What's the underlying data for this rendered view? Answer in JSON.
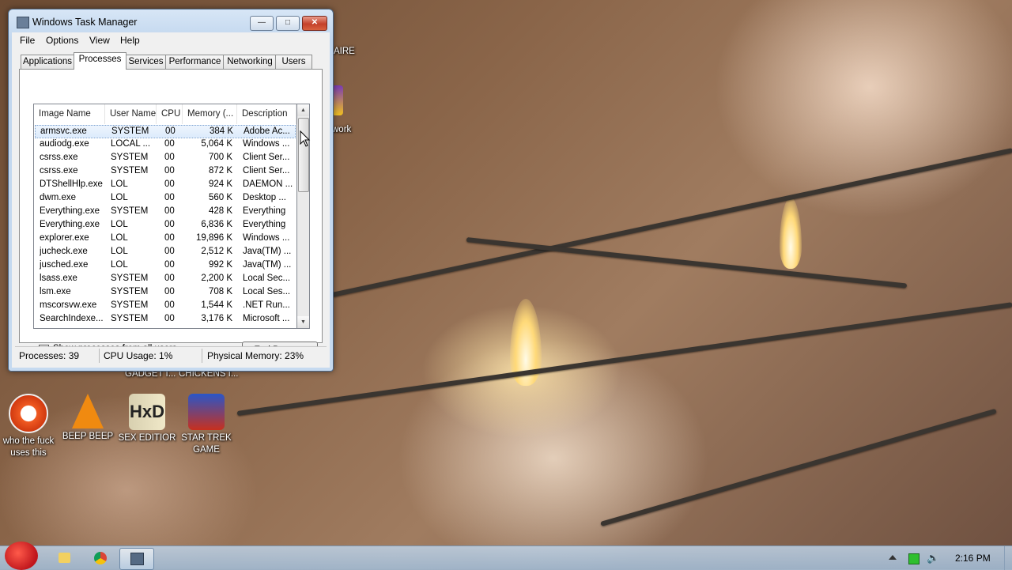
{
  "window": {
    "title": "Windows Task Manager",
    "controls": {
      "minimize": "—",
      "maximize": "□",
      "close": "✕"
    }
  },
  "menu": [
    "File",
    "Options",
    "View",
    "Help"
  ],
  "tabs": [
    "Applications",
    "Processes",
    "Services",
    "Performance",
    "Networking",
    "Users"
  ],
  "active_tab": "Processes",
  "columns": [
    "Image Name",
    "User Name",
    "CPU",
    "Memory (...",
    "Description"
  ],
  "processes": [
    {
      "image": "armsvc.exe",
      "user": "SYSTEM",
      "cpu": "00",
      "memory": "384 K",
      "desc": "Adobe Ac..."
    },
    {
      "image": "audiodg.exe",
      "user": "LOCAL ...",
      "cpu": "00",
      "memory": "5,064 K",
      "desc": "Windows ..."
    },
    {
      "image": "csrss.exe",
      "user": "SYSTEM",
      "cpu": "00",
      "memory": "700 K",
      "desc": "Client Ser..."
    },
    {
      "image": "csrss.exe",
      "user": "SYSTEM",
      "cpu": "00",
      "memory": "872 K",
      "desc": "Client Ser..."
    },
    {
      "image": "DTShellHlp.exe",
      "user": "LOL",
      "cpu": "00",
      "memory": "924 K",
      "desc": "DAEMON ..."
    },
    {
      "image": "dwm.exe",
      "user": "LOL",
      "cpu": "00",
      "memory": "560 K",
      "desc": "Desktop ..."
    },
    {
      "image": "Everything.exe",
      "user": "SYSTEM",
      "cpu": "00",
      "memory": "428 K",
      "desc": "Everything"
    },
    {
      "image": "Everything.exe",
      "user": "LOL",
      "cpu": "00",
      "memory": "6,836 K",
      "desc": "Everything"
    },
    {
      "image": "explorer.exe",
      "user": "LOL",
      "cpu": "00",
      "memory": "19,896 K",
      "desc": "Windows ..."
    },
    {
      "image": "jucheck.exe",
      "user": "LOL",
      "cpu": "00",
      "memory": "2,512 K",
      "desc": "Java(TM) ..."
    },
    {
      "image": "jusched.exe",
      "user": "LOL",
      "cpu": "00",
      "memory": "992 K",
      "desc": "Java(TM) ..."
    },
    {
      "image": "lsass.exe",
      "user": "SYSTEM",
      "cpu": "00",
      "memory": "2,200 K",
      "desc": "Local Sec..."
    },
    {
      "image": "lsm.exe",
      "user": "SYSTEM",
      "cpu": "00",
      "memory": "708 K",
      "desc": "Local Ses..."
    },
    {
      "image": "mscorsvw.exe",
      "user": "SYSTEM",
      "cpu": "00",
      "memory": "1,544 K",
      "desc": ".NET Run..."
    },
    {
      "image": "SearchIndexe...",
      "user": "SYSTEM",
      "cpu": "00",
      "memory": "3,176 K",
      "desc": "Microsoft ..."
    }
  ],
  "show_all_label": "Show processes from all users",
  "show_all_checked": "✓",
  "end_process_label": "End Process",
  "status": {
    "processes": "Processes: 39",
    "cpu": "CPU Usage: 1%",
    "memory": "Physical Memory: 23%"
  },
  "desktop": {
    "partial_labels": [
      "AIRE",
      "work",
      "GADGET I...",
      "CHICKENS I..."
    ],
    "icons": [
      {
        "name": "who the fuck uses this",
        "line1": "who the fuck",
        "line2": "uses this"
      },
      {
        "name": "BEEP BEEP",
        "line1": "BEEP BEEP",
        "line2": ""
      },
      {
        "name": "SEX EDITIOR",
        "line1": "SEX EDITIOR",
        "line2": ""
      },
      {
        "name": "STAR TREK GAME",
        "line1": "STAR TREK",
        "line2": "GAME"
      }
    ]
  },
  "taskbar": {
    "clock": "2:16 PM"
  }
}
